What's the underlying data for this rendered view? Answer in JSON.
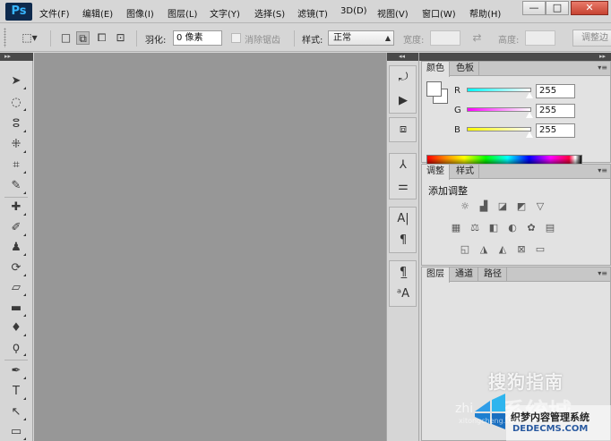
{
  "app": {
    "logo": "Ps"
  },
  "menu": [
    "文件(F)",
    "编辑(E)",
    "图像(I)",
    "图层(L)",
    "文字(Y)",
    "选择(S)",
    "滤镜(T)",
    "3D(D)",
    "视图(V)",
    "窗口(W)",
    "帮助(H)"
  ],
  "window_controls": {
    "minimize": "—",
    "maximize": "□",
    "close": "✕"
  },
  "options": {
    "feather_label": "羽化:",
    "feather_value": "0 像素",
    "antialias_label": "消除锯齿",
    "style_label": "样式:",
    "style_value": "正常",
    "width_label": "宽度:",
    "height_label": "高度:",
    "refine_label": "调整边"
  },
  "panels": {
    "color": {
      "tabs": [
        "颜色",
        "色板"
      ],
      "channels": [
        {
          "label": "R",
          "value": "255"
        },
        {
          "label": "G",
          "value": "255"
        },
        {
          "label": "B",
          "value": "255"
        }
      ]
    },
    "adjustments": {
      "tabs": [
        "调整",
        "样式"
      ],
      "title": "添加调整"
    },
    "layers": {
      "tabs": [
        "图层",
        "通道",
        "路径"
      ]
    }
  },
  "watermark": {
    "sogou": "搜狗指南",
    "zhi": "zhi",
    "xitongcheng": "系统城",
    "site_cn": "织梦内容管理系统",
    "site_url": "DEDECMS.COM",
    "url_small": "xitongcheng.com"
  },
  "colors": {
    "canvas": "#979797",
    "ui": "#d6d6d6",
    "header": "#4a4a4a",
    "ps_blue": "#38b6ff"
  }
}
